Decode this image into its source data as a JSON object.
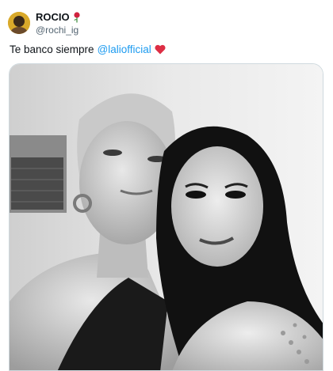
{
  "tweet": {
    "author": {
      "display_name": "ROCIO",
      "handle": "@rochi_ig",
      "badge_icon": "rose-icon",
      "avatar_icon": "avatar-photo"
    },
    "text": {
      "body": "Te banco siempre",
      "mention": "@laliofficial",
      "trailing_icon": "red-heart-icon"
    },
    "media": {
      "type": "photo",
      "style": "black-and-white"
    }
  },
  "colors": {
    "text": "#0f1419",
    "secondary": "#536471",
    "link": "#1d9bf0",
    "heart": "#e0245e",
    "border": "#cfd9de"
  }
}
